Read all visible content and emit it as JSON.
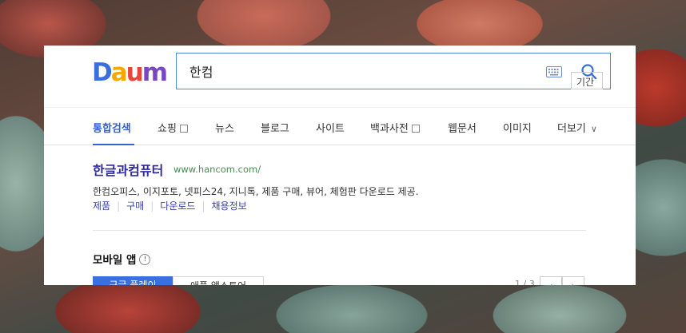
{
  "logo": {
    "text": "Daum",
    "letters": [
      "D",
      "a",
      "u",
      "m"
    ],
    "colors": [
      "#3b6fe0",
      "#f6a800",
      "#e8463a",
      "#7a46c4"
    ]
  },
  "search": {
    "value": "한컴"
  },
  "tabs": [
    {
      "label": "통합검색",
      "active": true
    },
    {
      "label": "쇼핑",
      "external": true
    },
    {
      "label": "뉴스"
    },
    {
      "label": "블로그"
    },
    {
      "label": "사이트"
    },
    {
      "label": "백과사전",
      "external": true
    },
    {
      "label": "웹문서"
    },
    {
      "label": "이미지"
    },
    {
      "label": "더보기",
      "dropdown": true
    }
  ],
  "period_button": "기간",
  "result": {
    "title": "한글과컴퓨터",
    "url": "www.hancom.com/",
    "description": "한컴오피스, 이지포토, 넷피스24, 지니톡, 제품 구매, 뷰어, 체험판 다운로드 제공.",
    "sublinks": [
      "제품",
      "구매",
      "다운로드",
      "채용정보"
    ]
  },
  "mobile_app": {
    "title": "모바일 앱",
    "stores": [
      "구글 플레이",
      "애플 앱스토어"
    ],
    "pager": "1 / 3"
  },
  "colors": {
    "accent": "#3560d6",
    "link": "#2e2aa0",
    "url": "#4a8a52"
  }
}
